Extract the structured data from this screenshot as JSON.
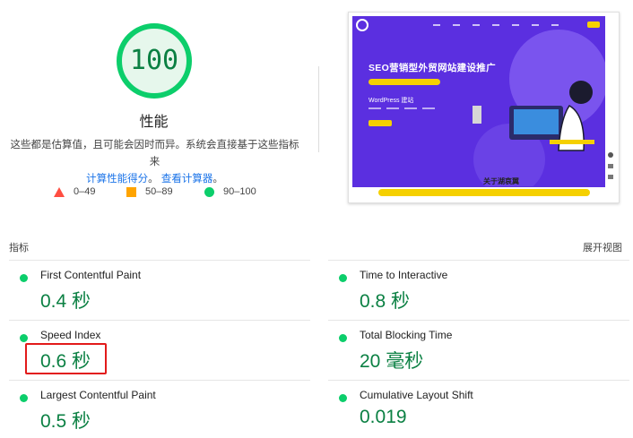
{
  "score": {
    "value": "100",
    "title": "性能",
    "ring_color": "#0cce6b",
    "ring_bg": "#e6f7ec",
    "text_color": "#0b8043",
    "fraction": 1.0
  },
  "description": {
    "line1": "这些都是估算值，且可能会因时而异。系统会直接基于这些指标来",
    "link1": "计算性能得分",
    "sep": "。",
    "link2": "查看计算器",
    "end": "。"
  },
  "legend": [
    {
      "label": "0–49",
      "shape": "triangle",
      "color": "#ff4e42"
    },
    {
      "label": "50–89",
      "shape": "square",
      "color": "#ffa400"
    },
    {
      "label": "90–100",
      "shape": "circle",
      "color": "#0cce6b"
    }
  ],
  "thumbnail": {
    "headline": "SEO营销型外贸网站建设推广",
    "sub": "WordPress 建站",
    "section_title": "关于湖哀翼",
    "hero_color": "#5b2fe0",
    "accent_color": "#f5d000"
  },
  "metrics": {
    "header": "指标",
    "expand_label": "展开视图",
    "items": [
      {
        "title": "First Contentful Paint",
        "value": "0.4 秒",
        "status_color": "#0cce6b"
      },
      {
        "title": "Time to Interactive",
        "value": "0.8 秒",
        "status_color": "#0cce6b"
      },
      {
        "title": "Speed Index",
        "value": "0.6 秒",
        "status_color": "#0cce6b"
      },
      {
        "title": "Total Blocking Time",
        "value": "20 毫秒",
        "status_color": "#0cce6b"
      },
      {
        "title": "Largest Contentful Paint",
        "value": "0.5 秒",
        "status_color": "#0cce6b"
      },
      {
        "title": "Cumulative Layout Shift",
        "value": "0.019",
        "status_color": "#0cce6b"
      }
    ]
  }
}
